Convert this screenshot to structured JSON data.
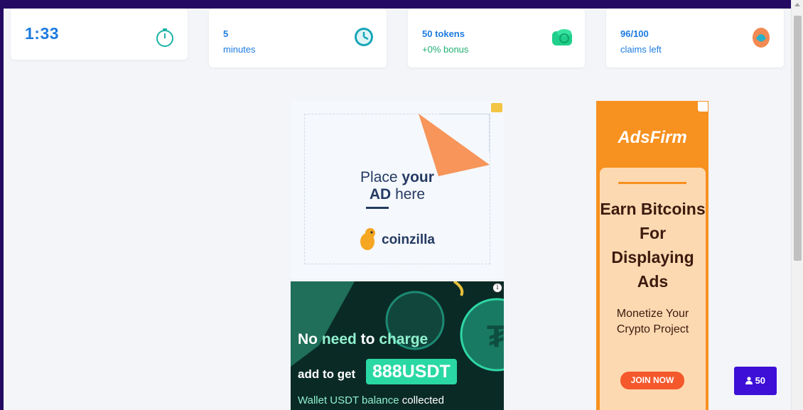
{
  "stats": {
    "timer": {
      "value": "1:33",
      "icon": "stopwatch-icon"
    },
    "duration": {
      "value": "5",
      "sub": "minutes",
      "icon": "clock-icon"
    },
    "reward": {
      "value": "50 tokens",
      "sub": "+0% bonus",
      "icon": "coin-stack-icon"
    },
    "claims": {
      "value": "96/100",
      "sub": "claims left",
      "icon": "egg-icon"
    }
  },
  "ads": {
    "coinzilla": {
      "line1a": "Place ",
      "line1b": "your",
      "line2a": "AD",
      "line2b": " here",
      "brand": "coinzilla"
    },
    "usdt": {
      "line1a": "No ",
      "line1b": "need",
      "line1c": " to ",
      "line1d": "charge",
      "line2": "add to get",
      "amount": "888USDT",
      "line3a": "Wallet USDT balance ",
      "line3b": "collected",
      "info": "i"
    },
    "adsfirm": {
      "brand": "AdsFirm",
      "headline": "Earn Bitcoins For Displaying Ads",
      "subline": "Monetize Your Crypto Project",
      "button": "JOIN NOW"
    }
  },
  "user_badge": {
    "count": "50",
    "icon": "user-icon"
  },
  "colors": {
    "primary": "#1e7be0",
    "green": "#20b073",
    "topbar": "#240a63",
    "badge": "#3d0fd7",
    "adsfirm_orange": "#f79120"
  }
}
